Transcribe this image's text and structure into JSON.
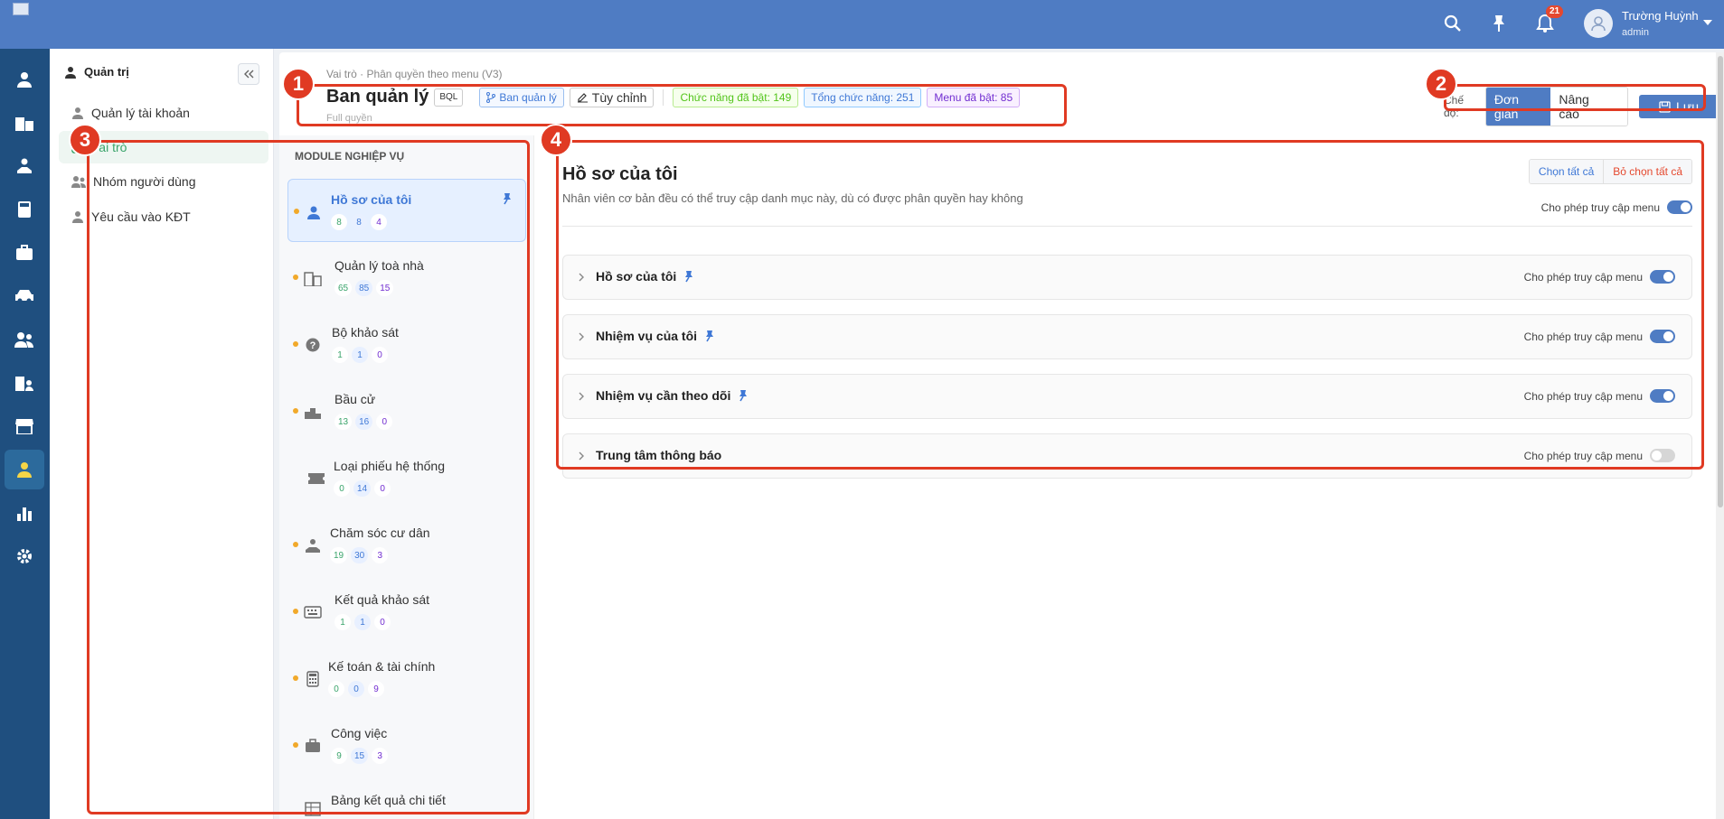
{
  "topbar": {
    "notif_count": "21",
    "user_name": "Trường Huỳnh",
    "user_role": "admin"
  },
  "sidebar": {
    "header": "Quản trị",
    "items": [
      {
        "label": "Quản lý tài khoản"
      },
      {
        "label": "Vai trò"
      },
      {
        "label": "Nhóm người dùng"
      },
      {
        "label": "Yêu cầu vào KĐT"
      }
    ]
  },
  "header": {
    "breadcrumb": "Vai trò · Phân quyền theo menu (V3)",
    "title": "Ban quản lý",
    "code_tag": "BQL",
    "role_tag": "Ban quản lý",
    "custom_btn": "Tùy chỉnh",
    "stat_enabled_funcs": "Chức năng đã bật: 149",
    "stat_total_funcs": "Tổng chức năng: 251",
    "stat_enabled_menus": "Menu đã bật: 85",
    "subtitle": "Full quyền",
    "mode_label": "Chế độ:",
    "mode_simple": "Đơn giản",
    "mode_advanced": "Nâng cao",
    "save": "Lưu"
  },
  "modules": {
    "heading": "MODULE NGHIỆP VỤ",
    "items": [
      {
        "label": "Hồ sơ của tôi",
        "c1": "8",
        "c2": "8",
        "c3": "4",
        "icon": "user-icon"
      },
      {
        "label": "Quản lý toà nhà",
        "c1": "65",
        "c2": "85",
        "c3": "15",
        "icon": "building-icon"
      },
      {
        "label": "Bộ khảo sát",
        "c1": "1",
        "c2": "1",
        "c3": "0",
        "icon": "question-icon"
      },
      {
        "label": "Bầu cử",
        "c1": "13",
        "c2": "16",
        "c3": "0",
        "icon": "podium-icon"
      },
      {
        "label": "Loại phiếu hệ thống",
        "c1": "0",
        "c2": "14",
        "c3": "0",
        "icon": "ticket-icon"
      },
      {
        "label": "Chăm sóc cư dân",
        "c1": "19",
        "c2": "30",
        "c3": "3",
        "icon": "care-icon"
      },
      {
        "label": "Kết quả khảo sát",
        "c1": "1",
        "c2": "1",
        "c3": "0",
        "icon": "keyboard-icon"
      },
      {
        "label": "Kế toán & tài chính",
        "c1": "0",
        "c2": "0",
        "c3": "9",
        "icon": "calculator-icon"
      },
      {
        "label": "Công việc",
        "c1": "9",
        "c2": "15",
        "c3": "3",
        "icon": "briefcase-icon"
      },
      {
        "label": "Bảng kết quả chi tiết",
        "icon": "table-icon"
      }
    ]
  },
  "content": {
    "title": "Hồ sơ của tôi",
    "desc": "Nhân viên cơ bản đều có thể truy cập danh mục này, dù có được phân quyền hay không",
    "select_all": "Chọn tất cả",
    "unselect_all": "Bỏ chọn tất cả",
    "allow_label": "Cho phép truy cập menu",
    "sections": [
      {
        "label": "Hồ sơ của tôi",
        "on": true
      },
      {
        "label": "Nhiệm vụ của tôi",
        "on": true
      },
      {
        "label": "Nhiệm vụ cần theo dõi",
        "on": true
      },
      {
        "label": "Trung tâm thông báo",
        "on": false
      }
    ]
  },
  "callouts": [
    "1",
    "2",
    "3",
    "4"
  ],
  "colors": {
    "primary": "#4f7cc3",
    "rail": "#1f4f7f",
    "callout": "#e03a23"
  }
}
